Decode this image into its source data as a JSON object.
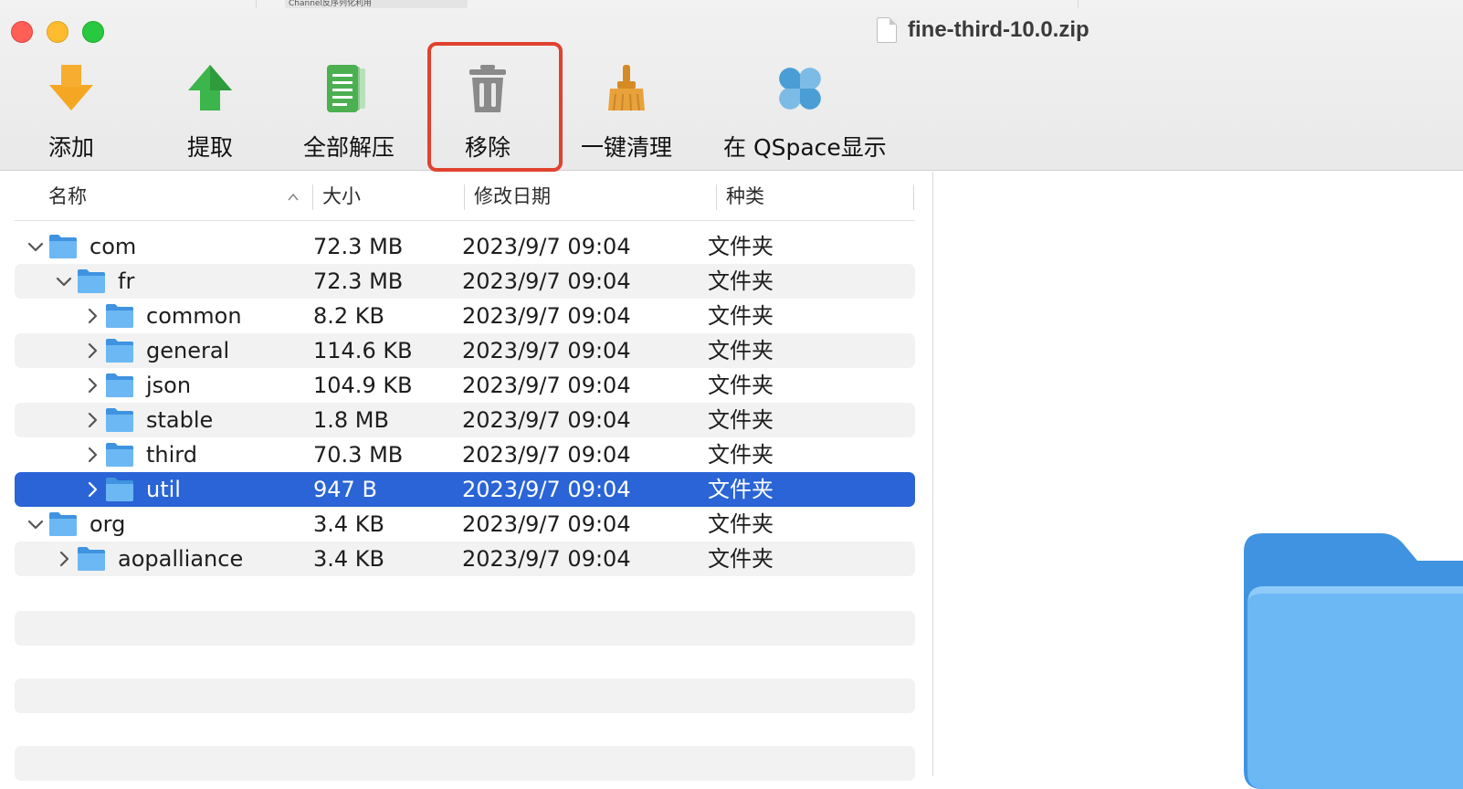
{
  "background_window": {
    "tab_text": "Channel反序列化利用"
  },
  "window": {
    "title": "fine-third-10.0.zip",
    "title_icon": "zip-document-icon"
  },
  "toolbar": {
    "items": [
      {
        "label": "添加",
        "icon": "add-arrow-down-icon",
        "color": "#f5a623"
      },
      {
        "label": "提取",
        "icon": "extract-arrow-up-icon",
        "color": "#3cb54a"
      },
      {
        "label": "全部解压",
        "icon": "extract-all-document-icon",
        "color": "#4caf50"
      },
      {
        "label": "移除",
        "icon": "trash-icon",
        "color": "#8a8a8a"
      },
      {
        "label": "一键清理",
        "icon": "broom-icon",
        "color": "#e9a23b"
      },
      {
        "label": "在 QSpace显示",
        "icon": "qspace-clover-icon",
        "color": "#4a9ed6"
      }
    ],
    "highlighted_item": "移除",
    "highlight_color": "#e0422f"
  },
  "columns": {
    "name": "名称",
    "size": "大小",
    "date": "修改日期",
    "kind": "种类"
  },
  "rows": [
    {
      "name": "com",
      "size": "72.3 MB",
      "date": "2023/9/7 09:04",
      "kind": "文件夹",
      "expanded": true,
      "depth": 0
    },
    {
      "name": "fr",
      "size": "72.3 MB",
      "date": "2023/9/7 09:04",
      "kind": "文件夹",
      "expanded": true,
      "depth": 1
    },
    {
      "name": "common",
      "size": "8.2 KB",
      "date": "2023/9/7 09:04",
      "kind": "文件夹",
      "expanded": false,
      "depth": 2
    },
    {
      "name": "general",
      "size": "114.6 KB",
      "date": "2023/9/7 09:04",
      "kind": "文件夹",
      "expanded": false,
      "depth": 2
    },
    {
      "name": "json",
      "size": "104.9 KB",
      "date": "2023/9/7 09:04",
      "kind": "文件夹",
      "expanded": false,
      "depth": 2
    },
    {
      "name": "stable",
      "size": "1.8 MB",
      "date": "2023/9/7 09:04",
      "kind": "文件夹",
      "expanded": false,
      "depth": 2
    },
    {
      "name": "third",
      "size": "70.3 MB",
      "date": "2023/9/7 09:04",
      "kind": "文件夹",
      "expanded": false,
      "depth": 2
    },
    {
      "name": "util",
      "size": "947 B",
      "date": "2023/9/7 09:04",
      "kind": "文件夹",
      "expanded": false,
      "depth": 2,
      "selected": true
    },
    {
      "name": "org",
      "size": "3.4 KB",
      "date": "2023/9/7 09:04",
      "kind": "文件夹",
      "expanded": true,
      "depth": 0
    },
    {
      "name": "aopalliance",
      "size": "3.4 KB",
      "date": "2023/9/7 09:04",
      "kind": "文件夹",
      "expanded": false,
      "depth": 1
    }
  ],
  "colors": {
    "selection": "#2a64d6",
    "folder": "#5aaef0",
    "alt_row": "#f2f2f2"
  }
}
